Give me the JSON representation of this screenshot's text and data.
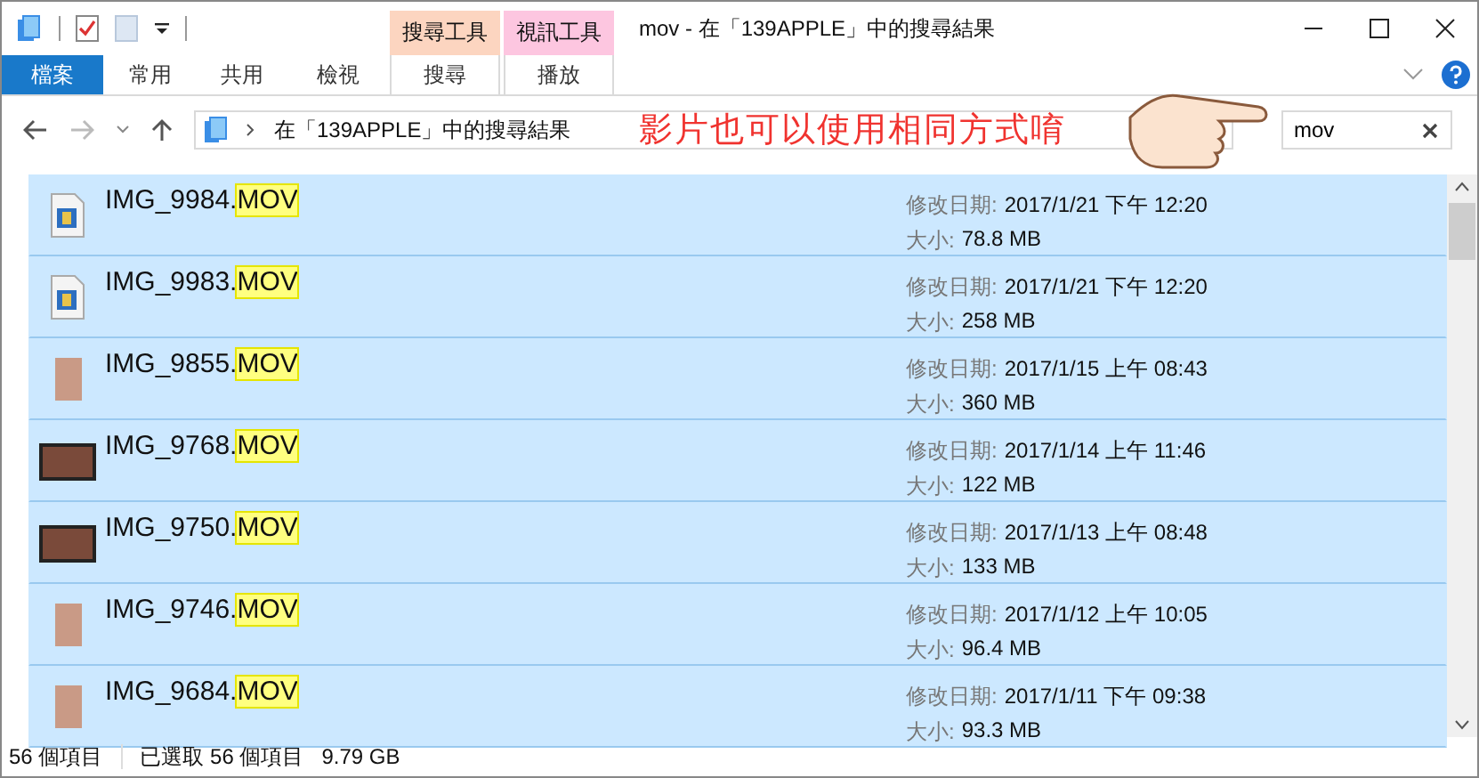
{
  "window": {
    "title": "mov - 在「139APPLE」中的搜尋結果"
  },
  "ribbon": {
    "tabs": [
      {
        "label": "檔案",
        "kind": "file",
        "selected": false
      },
      {
        "label": "常用",
        "kind": "normal",
        "selected": false
      },
      {
        "label": "共用",
        "kind": "normal",
        "selected": false
      },
      {
        "label": "檢視",
        "kind": "normal",
        "selected": false
      },
      {
        "label": "搜尋",
        "kind": "context",
        "context_label": "搜尋工具",
        "color": "#fcd5c0",
        "selected": false
      },
      {
        "label": "播放",
        "kind": "context",
        "context_label": "視訊工具",
        "color": "#fdc6e0",
        "selected": false
      }
    ]
  },
  "address_bar": {
    "path": "在「139APPLE」中的搜尋結果"
  },
  "search": {
    "value": "mov"
  },
  "annotation": {
    "text": "影片也可以使用相同方式唷"
  },
  "files": [
    {
      "name": "IMG_9984.",
      "match": "MOV",
      "kind": "file-icon",
      "date_label": "修改日期:",
      "date": "2017/1/21 下午 12:20",
      "size_label": "大小:",
      "size": "78.8 MB",
      "selected": true
    },
    {
      "name": "IMG_9983.",
      "match": "MOV",
      "kind": "file-icon",
      "date_label": "修改日期:",
      "date": "2017/1/21 下午 12:20",
      "size_label": "大小:",
      "size": "258 MB",
      "selected": true
    },
    {
      "name": "IMG_9855.",
      "match": "MOV",
      "kind": "portrait",
      "date_label": "修改日期:",
      "date": "2017/1/15 上午 08:43",
      "size_label": "大小:",
      "size": "360 MB",
      "selected": true
    },
    {
      "name": "IMG_9768.",
      "match": "MOV",
      "kind": "landscape",
      "date_label": "修改日期:",
      "date": "2017/1/14 上午 11:46",
      "size_label": "大小:",
      "size": "122 MB",
      "selected": true
    },
    {
      "name": "IMG_9750.",
      "match": "MOV",
      "kind": "landscape",
      "date_label": "修改日期:",
      "date": "2017/1/13 上午 08:48",
      "size_label": "大小:",
      "size": "133 MB",
      "selected": true
    },
    {
      "name": "IMG_9746.",
      "match": "MOV",
      "kind": "portrait",
      "date_label": "修改日期:",
      "date": "2017/1/12 上午 10:05",
      "size_label": "大小:",
      "size": "96.4 MB",
      "selected": true
    },
    {
      "name": "IMG_9684.",
      "match": "MOV",
      "kind": "portrait",
      "date_label": "修改日期:",
      "date": "2017/1/11 下午 09:38",
      "size_label": "大小:",
      "size": "93.3 MB",
      "selected": true
    }
  ],
  "status_bar": {
    "count": "56 個項目",
    "selection": "已選取 56 個項目",
    "selection_size": "9.79 GB"
  }
}
